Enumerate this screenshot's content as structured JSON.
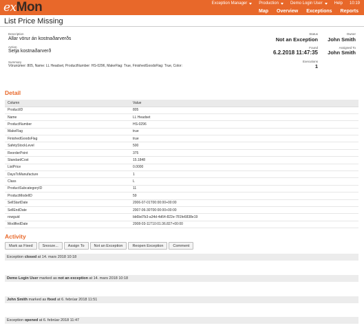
{
  "brand": {
    "ex": "ex",
    "mon": "Mon"
  },
  "topmenu": {
    "exception_manager": "Exception Manager",
    "production": "Production",
    "user": "Demo Login User",
    "help": "Help",
    "time": "10:19"
  },
  "nav": [
    "Map",
    "Overview",
    "Exceptions",
    "Reports"
  ],
  "page": {
    "title": "List Price Missing"
  },
  "info": {
    "description_label": "Description",
    "description": "Allar vörur án kostnaðarverðs",
    "action_label": "Action",
    "action": "Setja kostnaðarverð",
    "summary_label": "Summary",
    "summary": "Vörunúmer: 805, Name: LL Headset, ProductNumber: HS-0296, MakeFlag: True, FinishedGoodsFlag: True, Color:",
    "status_label": "Status",
    "status": "Not an Exception",
    "owner_label": "Owner",
    "owner": "John Smith",
    "found_label": "Found",
    "found": "6.2.2018 11:47:35",
    "assigned_label": "Assigned To",
    "assigned": "John Smith",
    "executions_label": "Executions",
    "executions": "1"
  },
  "detail": {
    "heading": "Detail",
    "columns": [
      "Column",
      "Value"
    ],
    "rows": [
      [
        "ProductID",
        "805"
      ],
      [
        "Name",
        "LL Headset"
      ],
      [
        "ProductNumber",
        "HS-0296"
      ],
      [
        "MakeFlag",
        "true"
      ],
      [
        "FinishedGoodsFlag",
        "true"
      ],
      [
        "SafetyStockLevel",
        "500"
      ],
      [
        "ReorderPoint",
        "375"
      ],
      [
        "StandardCost",
        "15.1848"
      ],
      [
        "ListPrice",
        "0.0000"
      ],
      [
        "DaysToManufacture",
        "1"
      ],
      [
        "Class",
        "L"
      ],
      [
        "ProductSubcategoryID",
        "11"
      ],
      [
        "ProductModelID",
        "59"
      ],
      [
        "SellStartDate",
        "2006-07-01T00:00:00+00:00"
      ],
      [
        "SellEndDate",
        "2007-06-30T00:00:00+00:00"
      ],
      [
        "rowguid",
        "bb6bd7b3-a34d-4d64-822e-781fe6838e19"
      ],
      [
        "ModifiedDate",
        "2008-03-11T10:01:36.827+00:00"
      ]
    ]
  },
  "activity": {
    "heading": "Activity",
    "buttons": [
      "Mark as Fixed",
      "Snooze...",
      "Assign To",
      "Not an Exception",
      "Reopen Exception",
      "Comment"
    ],
    "entries": [
      {
        "a": "Exception ",
        "b": "closed",
        "c": " at 14. mars 2018 10:18"
      },
      {
        "a": "",
        "b": "Demo Login User",
        "c": " marked as ",
        "d": "not an exception",
        "e": " at 14. mars 2018 10:18"
      },
      {
        "a": "",
        "b": "John Smith",
        "c": " marked as ",
        "d": "fixed",
        "e": " at 6. febrúar 2018 11:51"
      },
      {
        "a": "Exception ",
        "b": "opened",
        "c": " at 6. febrúar 2018 11:47"
      }
    ]
  }
}
